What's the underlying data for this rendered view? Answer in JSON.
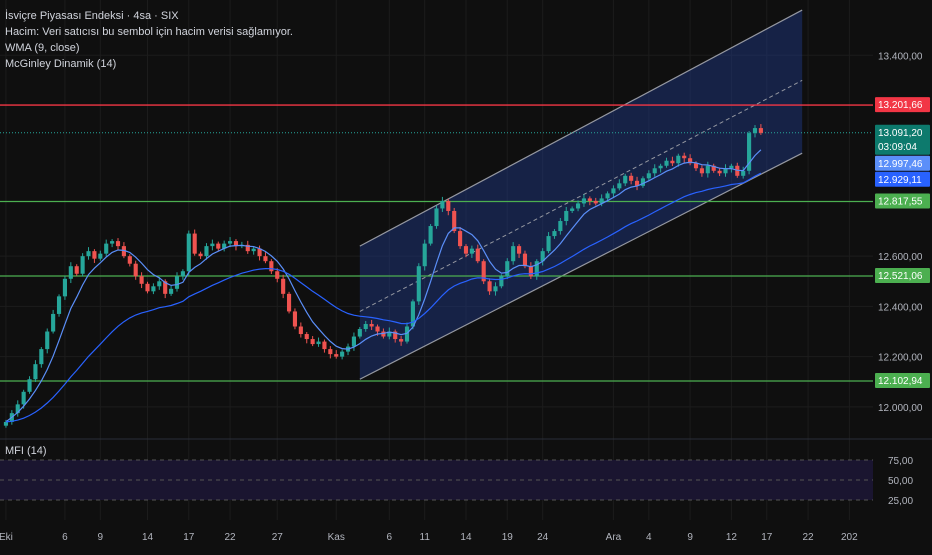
{
  "legend": {
    "title": "İsviçre Piyasası Endeksi · 4sa · SIX",
    "volume_note": "Hacim: Veri satıcısı bu sembol için hacim verisi sağlamıyor.",
    "wma": "WMA (9, close)",
    "mcginley": "McGinley Dinamik (14)"
  },
  "mfi_label": "MFI (14)",
  "colors": {
    "background": "#0f0f0f",
    "up": "#26a69a",
    "down": "#ef5350",
    "wma": "#5b8ff9",
    "mcginley": "#2962ff",
    "channel_fill": "#1e3a8a",
    "support": "#4caf50",
    "resistance": "#f23645",
    "grid": "#1c1c1c"
  },
  "chart_data": {
    "type": "candlestick",
    "price_axis": {
      "ticks": [
        "13.400,00",
        "12.600,00",
        "12.400,00",
        "12.200,00",
        "12.000,00"
      ],
      "tick_values": [
        13400,
        12600,
        12400,
        12200,
        12000
      ],
      "range": [
        11880,
        13620
      ]
    },
    "x_axis_labels": [
      "Eki",
      "6",
      "9",
      "14",
      "17",
      "22",
      "27",
      "Kas",
      "6",
      "11",
      "14",
      "19",
      "24",
      "Ara",
      "4",
      "9",
      "12",
      "17",
      "22",
      "202"
    ],
    "x_label_index": [
      0,
      10,
      16,
      24,
      31,
      38,
      46,
      56,
      65,
      71,
      78,
      85,
      91,
      103,
      109,
      116,
      123,
      129,
      136,
      143
    ],
    "horizontal_levels": [
      {
        "label": "13.201,66",
        "value": 13201.66,
        "kind": "resistance"
      },
      {
        "label": "12.817,55",
        "value": 12817.55,
        "kind": "support"
      },
      {
        "label": "12.521,06",
        "value": 12521.06,
        "kind": "support"
      },
      {
        "label": "12.102,94",
        "value": 12102.94,
        "kind": "support"
      }
    ],
    "price_badges": [
      {
        "label": "13.091,20",
        "sub": "03:09:04",
        "value": 13091.2,
        "kind": "last"
      },
      {
        "label": "12.997,46",
        "value": 12997.46,
        "kind": "wma"
      },
      {
        "label": "12.929,11",
        "value": 12929.11,
        "kind": "mcginley"
      }
    ],
    "channel": {
      "start_index": 60,
      "end_index": 135,
      "upper_start": 12640,
      "upper_end": 13580,
      "mid_start": 12380,
      "mid_end": 13300,
      "lower_start": 12110,
      "lower_end": 13010
    },
    "mfi": {
      "ticks": [
        "75,00",
        "50,00",
        "25,00"
      ],
      "tick_values": [
        75,
        50,
        25
      ]
    },
    "close": [
      11940,
      11975,
      12010,
      12060,
      12110,
      12170,
      12230,
      12300,
      12370,
      12440,
      12510,
      12560,
      12530,
      12600,
      12620,
      12590,
      12610,
      12650,
      12660,
      12640,
      12600,
      12570,
      12520,
      12490,
      12460,
      12480,
      12500,
      12450,
      12470,
      12520,
      12540,
      12690,
      12610,
      12600,
      12640,
      12650,
      12630,
      12650,
      12660,
      12640,
      12645,
      12620,
      12630,
      12600,
      12580,
      12540,
      12510,
      12450,
      12380,
      12320,
      12290,
      12270,
      12250,
      12260,
      12230,
      12210,
      12200,
      12220,
      12240,
      12280,
      12310,
      12330,
      12320,
      12300,
      12280,
      12300,
      12270,
      12260,
      12320,
      12420,
      12560,
      12650,
      12720,
      12790,
      12820,
      12780,
      12700,
      12640,
      12610,
      12630,
      12580,
      12500,
      12460,
      12480,
      12520,
      12580,
      12640,
      12610,
      12560,
      12520,
      12580,
      12620,
      12680,
      12700,
      12740,
      12780,
      12790,
      12810,
      12830,
      12820,
      12810,
      12830,
      12850,
      12870,
      12890,
      12920,
      12900,
      12880,
      12910,
      12930,
      12950,
      12960,
      12980,
      12970,
      13000,
      12990,
      12970,
      12950,
      12930,
      12960,
      12940,
      12930,
      12950,
      12960,
      12920,
      12940,
      13090,
      13110,
      13091
    ]
  }
}
